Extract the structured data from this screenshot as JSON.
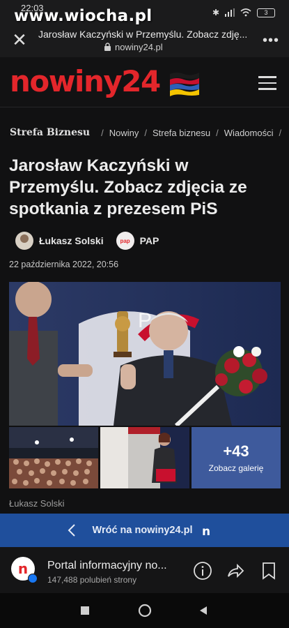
{
  "status_bar": {
    "time": "22:03",
    "watermark": "www.wiocha.pl",
    "battery": "3"
  },
  "browser": {
    "page_title": "Jarosław Kaczyński w Przemyślu. Zobacz zdję...",
    "domain": "nowiny24.pl"
  },
  "site": {
    "logo": "nowiny24"
  },
  "breadcrumb": {
    "brand": "Strefa Biznesu",
    "items": [
      "Nowiny",
      "Strefa biznesu",
      "Wiadomości"
    ]
  },
  "article": {
    "title": "Jarosław Kaczyński w Przemyślu. Zobacz zdjęcia ze spotkania z prezesem PiS",
    "author": "Łukasz Solski",
    "agency": "PAP",
    "agency_logo": "pap",
    "date": "22 października 2022, 20:56",
    "gallery_count": "+43",
    "gallery_label": "Zobacz galerię",
    "photo_caption": "Łukasz Solski"
  },
  "back_bar": {
    "label": "Wróć na nowiny24.pl",
    "badge": "n"
  },
  "fb_page": {
    "avatar_letter": "n",
    "name": "Portal informacyjny no...",
    "likes": "147,488 polubień strony"
  },
  "colors": {
    "brand_red": "#e3262b",
    "back_bar": "#1f4f9c",
    "gallery_tile": "#3e5a9c"
  }
}
